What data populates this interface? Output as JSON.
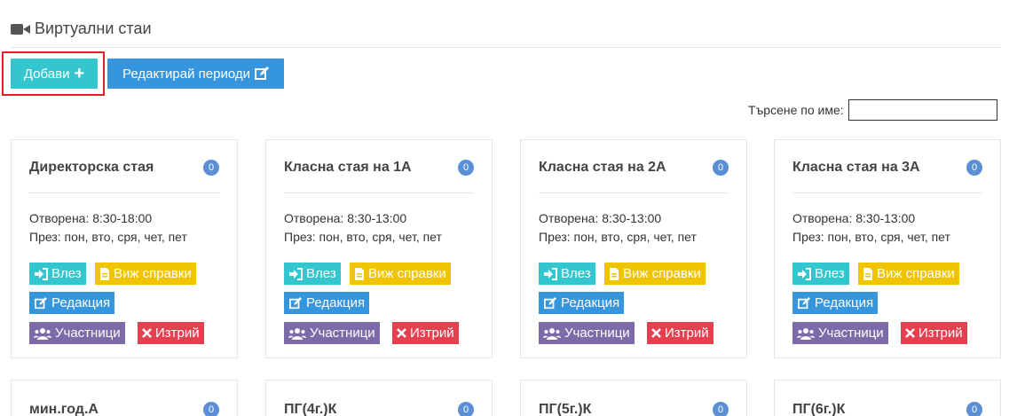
{
  "header": {
    "icon": "video-camera-icon",
    "title": "Виртуални стаи"
  },
  "toolbar": {
    "add_label": "Добави",
    "add_icon": "plus-icon",
    "edit_periods_label": "Редактирай периоди",
    "edit_periods_icon": "edit-icon"
  },
  "search": {
    "label": "Търсене по име:",
    "value": ""
  },
  "actions": {
    "enter": "Влез",
    "reports": "Виж справки",
    "edit": "Редакция",
    "members": "Участници",
    "delete": "Изтрий"
  },
  "rooms": [
    {
      "name": "Директорска стая",
      "count": "0",
      "open": "Отворена: 8:30-18:00",
      "days": "През: пон, вто, сря, чет, пет"
    },
    {
      "name": "Класна стая на 1А",
      "count": "0",
      "open": "Отворена: 8:30-13:00",
      "days": "През: пон, вто, сря, чет, пет"
    },
    {
      "name": "Класна стая на 2А",
      "count": "0",
      "open": "Отворена: 8:30-13:00",
      "days": "През: пон, вто, сря, чет, пет"
    },
    {
      "name": "Класна стая на 3А",
      "count": "0",
      "open": "Отворена: 8:30-13:00",
      "days": "През: пон, вто, сря, чет, пет"
    },
    {
      "name": "мин.год.А",
      "count": "0"
    },
    {
      "name": "ПГ(4г.)К",
      "count": "0"
    },
    {
      "name": "ПГ(5г.)К",
      "count": "0"
    },
    {
      "name": "ПГ(6г.)К",
      "count": "0"
    }
  ],
  "colors": {
    "accent_cyan": "#33c6cf",
    "accent_blue": "#3595dd",
    "warning_yellow": "#f0c400",
    "purple": "#7d6aa8",
    "danger_red": "#e4404f",
    "badge_blue": "#5a8fd6",
    "highlight_red": "#e0202a"
  }
}
